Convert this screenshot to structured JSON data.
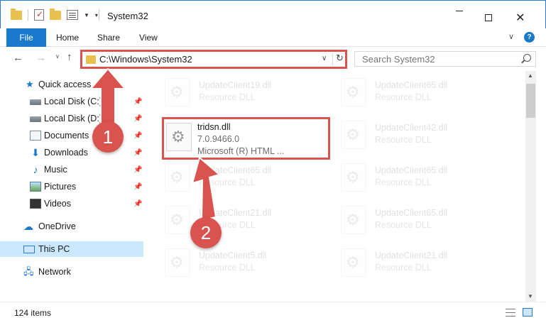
{
  "window": {
    "title": "System32"
  },
  "ribbon": {
    "tabs": [
      "File",
      "Home",
      "Share",
      "View"
    ],
    "help_label": "?"
  },
  "address": {
    "path": "C:\\Windows\\System32"
  },
  "search": {
    "placeholder": "Search System32"
  },
  "sidebar": {
    "items": [
      {
        "label": "Quick access",
        "icon": "star-icon",
        "pinned": false
      },
      {
        "label": "Local Disk (C:)",
        "icon": "disk-icon",
        "pinned": true
      },
      {
        "label": "Local Disk (D:)",
        "icon": "disk-icon",
        "pinned": true
      },
      {
        "label": "Documents",
        "icon": "documents-icon",
        "pinned": true
      },
      {
        "label": "Downloads",
        "icon": "downloads-icon",
        "pinned": true
      },
      {
        "label": "Music",
        "icon": "music-icon",
        "pinned": true
      },
      {
        "label": "Pictures",
        "icon": "pictures-icon",
        "pinned": true
      },
      {
        "label": "Videos",
        "icon": "videos-icon",
        "pinned": true
      },
      {
        "label": "OneDrive",
        "icon": "onedrive-icon",
        "pinned": false
      },
      {
        "label": "This PC",
        "icon": "this-pc-icon",
        "pinned": false,
        "selected": true
      },
      {
        "label": "Network",
        "icon": "network-icon",
        "pinned": false
      }
    ]
  },
  "files": {
    "highlighted": {
      "name": "tridsn.dll",
      "version": "7.0.9466.0",
      "description": "Microsoft (R) HTML ..."
    },
    "background": [
      {
        "name": "UpdateClient19.dll",
        "type": "Resource DLL"
      },
      {
        "name": "UpdateClient65.dll",
        "type": "Resource DLL"
      },
      {
        "name": "UpdateClient42.dll",
        "type": "Resource DLL"
      },
      {
        "name": "UpdateClient65.dll",
        "type": "Resource DLL"
      },
      {
        "name": "UpdateClient65.dll",
        "type": "Resource DLL"
      },
      {
        "name": "UpdateClient21.dll",
        "type": "Resource DLL"
      },
      {
        "name": "UpdateClient65.dll",
        "type": "Resource DLL"
      },
      {
        "name": "UpdateClient5.dll",
        "type": "Resource DLL"
      },
      {
        "name": "UpdateClient21.dll",
        "type": "Resource DLL"
      }
    ]
  },
  "status": {
    "item_count": "124 items"
  },
  "annotations": {
    "step1": "1",
    "step2": "2",
    "highlight_color": "#d9534f"
  },
  "colors": {
    "accent": "#1979ca",
    "selected_bg": "#cce8ff"
  }
}
